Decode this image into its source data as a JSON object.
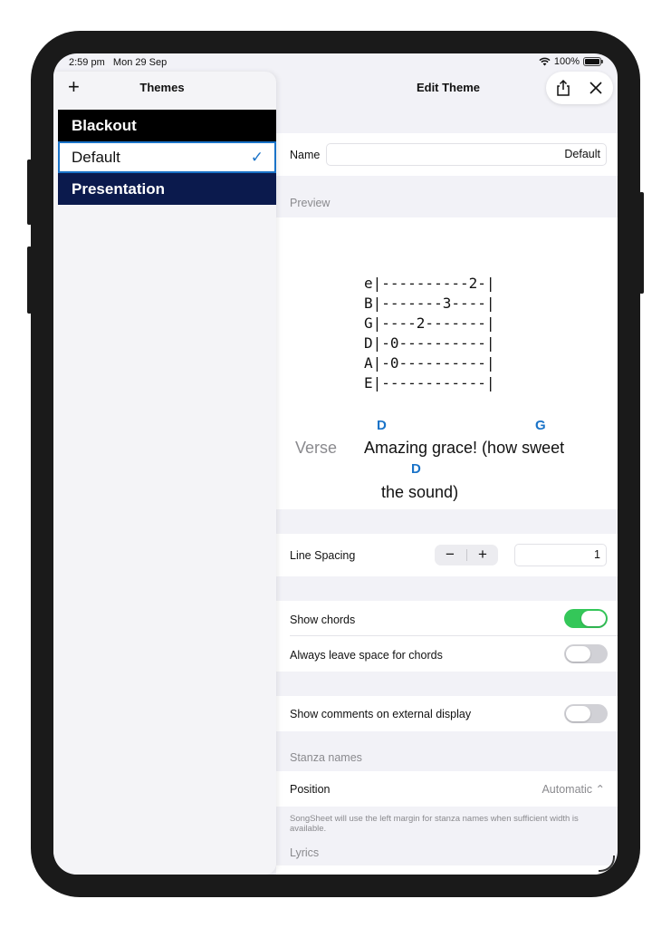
{
  "status": {
    "time": "2:59 pm",
    "date": "Mon 29 Sep",
    "battery": "100%"
  },
  "sidebar": {
    "title": "Themes",
    "add_glyph": "+",
    "themes": [
      {
        "label": "Blackout"
      },
      {
        "label": "Default",
        "selected_mark": "✓"
      },
      {
        "label": "Presentation"
      }
    ]
  },
  "detail": {
    "title": "Edit Theme",
    "name_label": "Name",
    "name_value": "Default",
    "preview_header": "Preview",
    "preview": {
      "tab_lines": [
        "e|----------2-|",
        "B|-------3----|",
        "G|----2-------|",
        "D|-0----------|",
        "A|-0----------|",
        "E|------------|"
      ],
      "chord_1": "D",
      "chord_2": "G",
      "chord_3": "D",
      "verse_label": "Verse",
      "lyric_line_1": "Amazing grace! (how sweet",
      "lyric_line_2": "the sound)"
    },
    "line_spacing_label": "Line Spacing",
    "stepper_minus": "−",
    "stepper_plus": "+",
    "line_spacing_value": "1",
    "show_chords_label": "Show chords",
    "show_chords": true,
    "always_space_label": "Always leave space for chords",
    "always_space": false,
    "show_comments_label": "Show comments on external display",
    "show_comments": false,
    "stanza_header": "Stanza names",
    "position_label": "Position",
    "position_value": "Automatic ⌃",
    "footnote": "SongSheet will use the left margin for stanza names when sufficient width is available.",
    "lyrics_header": "Lyrics"
  },
  "colors": {
    "accent": "#1a73c8",
    "toggle_on": "#34c759",
    "presentation_bg": "#0b1a4d"
  }
}
